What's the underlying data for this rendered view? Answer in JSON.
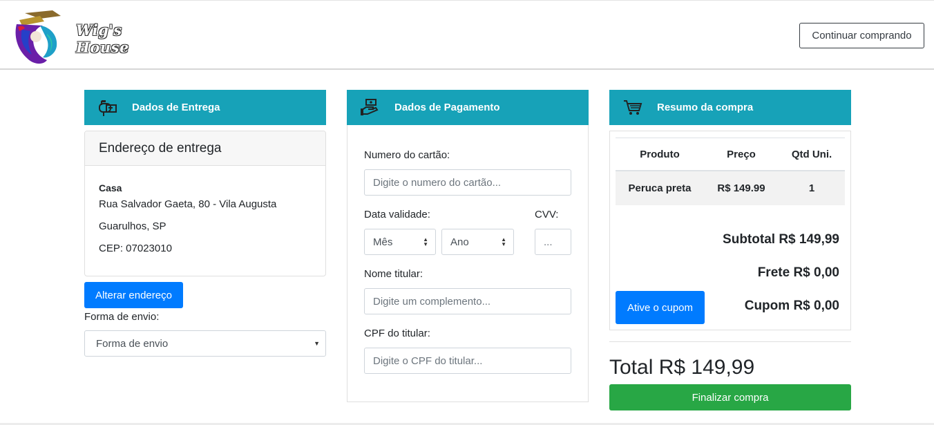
{
  "brand": {
    "logo_text": "Wig's House"
  },
  "header": {
    "continue_label": "Continuar comprando"
  },
  "delivery": {
    "header": "Dados de Entrega",
    "card_title": "Endereço de entrega",
    "address_name": "Casa",
    "address_line": "Rua Salvador Gaeta, 80 - Vila Augusta",
    "city": "Guarulhos, SP",
    "cep": "CEP: 07023010",
    "change_label": "Alterar endereço",
    "shipping_label": "Forma de envio:",
    "shipping_value": "Forma de envio"
  },
  "payment": {
    "header": "Dados de Pagamento",
    "card_number_label": "Numero do cartão:",
    "card_number_placeholder": "Digite o numero do cartão...",
    "expiry_label": "Data validade:",
    "month_value": "Mês",
    "year_value": "Ano",
    "cvv_label": "CVV:",
    "cvv_placeholder": "...",
    "holder_label": "Nome titular:",
    "holder_placeholder": "Digite um complemento...",
    "cpf_label": "CPF do titular:",
    "cpf_placeholder": "Digite o CPF do titular..."
  },
  "summary": {
    "header": "Resumo da compra",
    "columns": [
      "Produto",
      "Preço",
      "Qtd Uni."
    ],
    "rows": [
      {
        "product": "Peruca preta",
        "price": "R$ 149.99",
        "qty": "1"
      }
    ],
    "subtotal": "Subtotal R$ 149,99",
    "shipping": "Frete R$ 0,00",
    "coupon": "Cupom R$ 0,00",
    "coupon_button": "Ative o cupom",
    "total": "Total R$ 149,99",
    "checkout_button": "Finalizar compra"
  },
  "colors": {
    "section_header": "#17a2b8",
    "primary": "#007bff",
    "success": "#28a745"
  },
  "icons": {
    "delivery": "mailbox-icon",
    "payment": "money-hand-icon",
    "summary": "shopping-cart-icon"
  }
}
